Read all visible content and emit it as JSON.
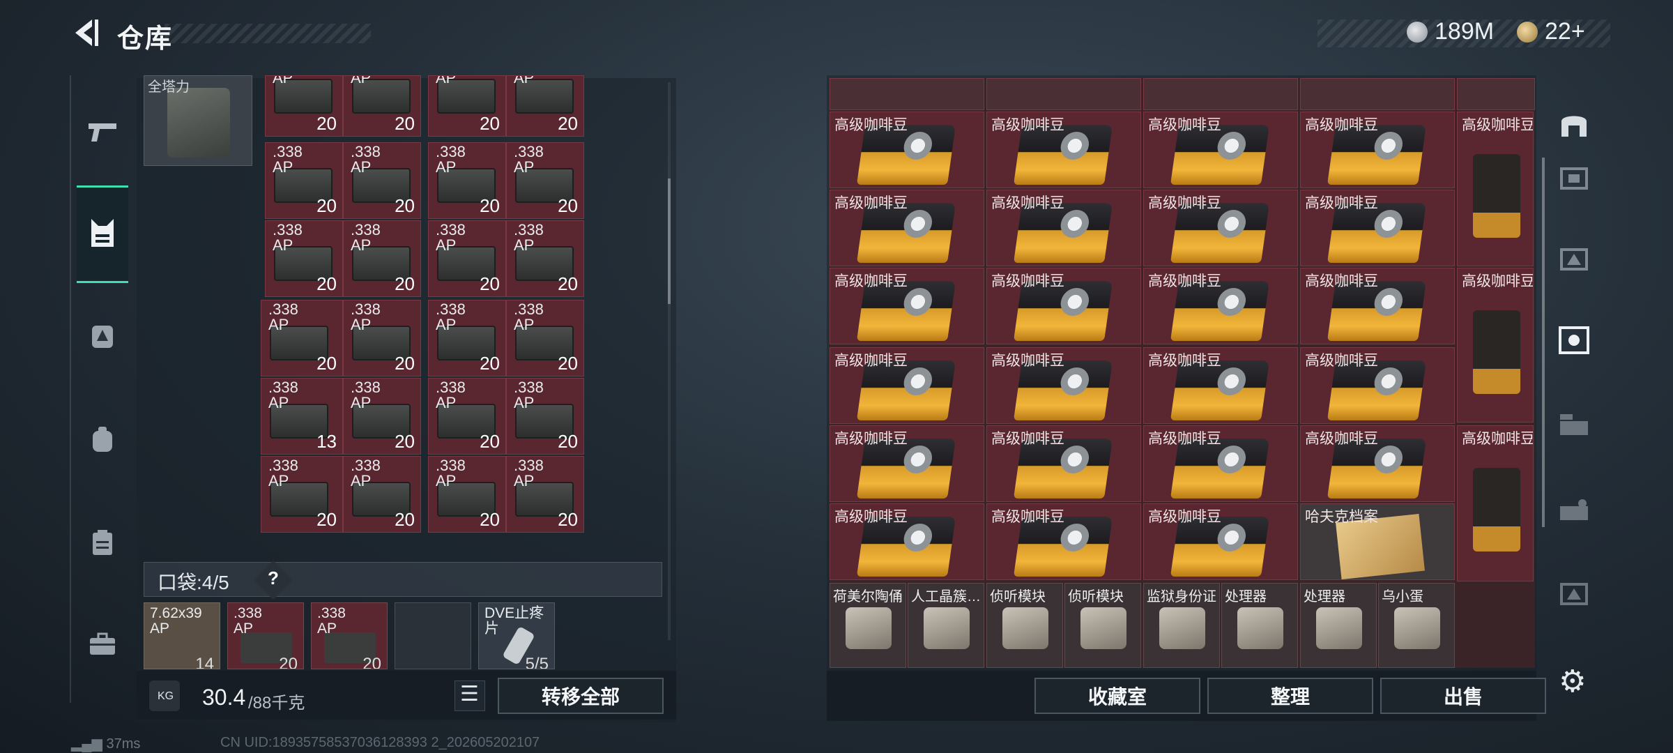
{
  "header": {
    "title": "仓库",
    "back_icon": "back-chevron-icon"
  },
  "currency": [
    {
      "icon": "silver-coin-icon",
      "value": "189M"
    },
    {
      "icon": "gold-coin-icon",
      "value": "22+"
    }
  ],
  "left_rail": {
    "items": [
      "weapon-icon",
      "vest-icon",
      "armor-icon",
      "backpack-icon",
      "clipboard-icon",
      "toolbox-icon"
    ],
    "active": 1
  },
  "vest": {
    "label": "全塔力"
  },
  "ammo": {
    "label_top": "AP",
    "caliber": ".338",
    "type": "AP",
    "row_top_counts": [
      "20",
      "20",
      "20",
      "20"
    ],
    "rows": [
      [
        "20",
        "20",
        "20",
        "20"
      ],
      [
        "20",
        "20",
        "20",
        "20"
      ],
      [
        "20",
        "20",
        "20",
        "20"
      ],
      [
        "13",
        "20",
        "20",
        "20"
      ],
      [
        "20",
        "20",
        "20",
        "20"
      ]
    ]
  },
  "pockets": {
    "label": "口袋:",
    "count": "4",
    "capacity": "/5",
    "help": "?",
    "items": [
      {
        "label": "7.62x39\nAP",
        "count": "14"
      },
      {
        "label": ".338\nAP",
        "count": "20"
      },
      {
        "label": ".338\nAP",
        "count": "20"
      },
      {
        "label": "",
        "count": ""
      },
      {
        "label": "DVE止疼片",
        "count": "5/5"
      }
    ]
  },
  "weight": {
    "current": "30.4",
    "max": "/88千克",
    "icon_label": "KG"
  },
  "buttons": {
    "transfer_all": "转移全部",
    "collection": "收藏室",
    "sort": "整理",
    "sell": "出售"
  },
  "storage": {
    "coffee_label": "高级咖啡豆",
    "row_lengths": [
      4,
      4,
      4,
      4,
      4,
      3
    ],
    "tall_coffee": [
      "高级咖啡豆",
      "高级咖啡豆",
      "高级咖啡豆"
    ],
    "file_label": "哈夫克档案",
    "bottom_items": [
      {
        "label": "荷美尔陶俑",
        "sub": ""
      },
      {
        "label": "人工晶簇…",
        "sub": ""
      },
      {
        "label": "侦听模块",
        "sub": ""
      },
      {
        "label": "侦听模块",
        "sub": ""
      },
      {
        "label": "监狱身份证",
        "sub": ""
      },
      {
        "label": "处理器",
        "sub": ""
      },
      {
        "label": "处理器",
        "sub": ""
      },
      {
        "label": "乌小蛋",
        "sub": ""
      }
    ]
  },
  "right_rail": {
    "items": [
      "stash-icon",
      "tier3-icon",
      "tier4-icon",
      "collection-icon",
      "gti-icon",
      "gti-2-icon",
      "tier4-b-icon"
    ],
    "active": 3
  },
  "status": {
    "ping": "37ms",
    "uid": "CN UID:18935758537036128393 2_202605202107"
  }
}
